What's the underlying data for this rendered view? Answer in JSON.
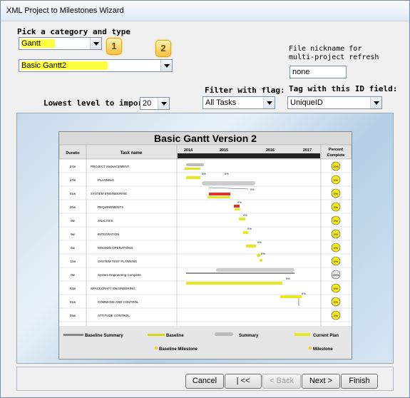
{
  "window": {
    "title": "XML Project to Milestones Wizard"
  },
  "category": {
    "heading": "Pick a category and type",
    "category_value": "Gantt",
    "type_value": "Basic Gantt2",
    "badge_1": "1",
    "badge_2": "2"
  },
  "nickname": {
    "label_line1": "File nickname for",
    "label_line2": "multi-project refresh",
    "value": "none"
  },
  "lowest_level": {
    "label": "Lowest level to import:",
    "value": "20"
  },
  "filter": {
    "label": "Filter with flag:",
    "value": "All Tasks"
  },
  "tag": {
    "label": "Tag with this ID field:",
    "value": "UniqueID"
  },
  "preview": {
    "title": "Basic Gantt Version 2",
    "col_duration": "Duratio",
    "col_task": "Task name",
    "col_percent_1": "Percent",
    "col_percent_2": "Complete",
    "years": [
      "2014",
      "2015",
      "2016",
      "2017"
    ],
    "rows": [
      {
        "duration": "27w",
        "task": "PROJECT MANAGEMENT",
        "percent": "10%"
      },
      {
        "duration": "27w",
        "task": "PLANNING",
        "percent": "0%"
      },
      {
        "duration": "61w",
        "task": "SYSTEM ENGINEERING",
        "percent": "0%"
      },
      {
        "duration": "26w",
        "task": "REQUIREMENTS",
        "percent": "0%"
      },
      {
        "duration": "9w",
        "task": "ANALYSIS",
        "percent": "0%"
      },
      {
        "duration": "9w",
        "task": "INTEGRATION",
        "percent": "0%"
      },
      {
        "duration": "6w",
        "task": "MISSION OPERATIONS",
        "percent": "0%"
      },
      {
        "duration": "12w",
        "task": "SYSTEM TEST PLANNING",
        "percent": "0%"
      },
      {
        "duration": "0w",
        "task": "System Engineering Complete",
        "percent": "100%"
      },
      {
        "duration": "93w",
        "task": "SPACECRAFT ENGINEERING",
        "percent": "0%"
      },
      {
        "duration": "61w",
        "task": "COMMAND AND CONTROL",
        "percent": "0%"
      },
      {
        "duration": "29w",
        "task": "ATTITUDE CONTROL",
        "percent": "0%"
      }
    ],
    "bar_labels": [
      "0%",
      "0%",
      "0%",
      "0%",
      "0%",
      "0%",
      "0%",
      "0%",
      "0%",
      "0%"
    ],
    "legend": {
      "baseline_summary": "Baseline Summary",
      "baseline": "Baseline",
      "summary": "Summary",
      "current_plan": "Current Plan",
      "baseline_milestone": "Baseline Milestone",
      "milestone": "Milestone"
    }
  },
  "buttons": {
    "cancel": "Cancel",
    "first": "| <<",
    "back": "< Back",
    "next": "Next >",
    "finish": "Finish"
  }
}
